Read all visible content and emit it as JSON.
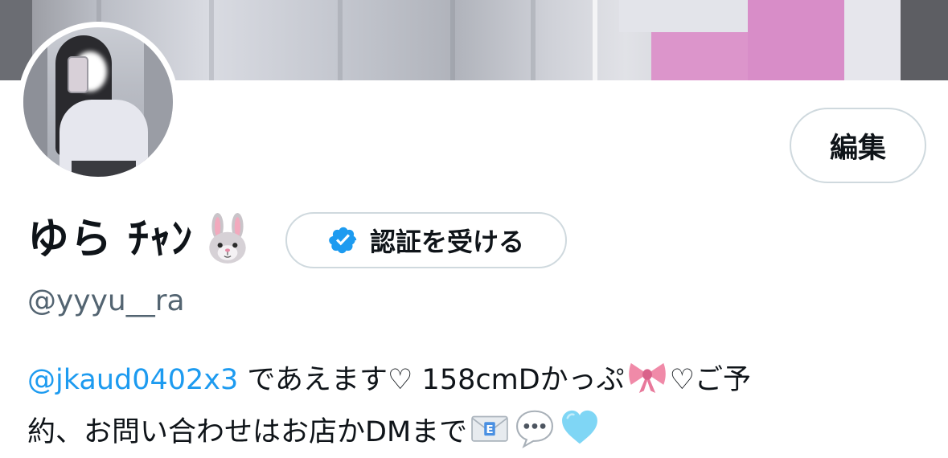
{
  "banner": {
    "image_description_icon": "banner-photo"
  },
  "avatar": {
    "icon": "profile-avatar"
  },
  "profile": {
    "display_name": "ゆら ﾁｬﾝ",
    "name_emoji_icon": "rabbit-face-icon",
    "handle": "@yyyu__ra",
    "edit_label": "編集",
    "verify_label": "認証を受ける",
    "verify_icon": "verified-badge-icon",
    "verify_color": "#1d9bf0"
  },
  "bio": {
    "mention": "@jkaud0402x3",
    "line1_text": " であえます♡ 158cmDかっぷ",
    "ribbon_icon": "ribbon-icon",
    "line1_tail": "♡ご予",
    "line2_text": "約、お問い合わせはお店かDMまで",
    "envelope_icon": "incoming-envelope-icon",
    "speech_icon": "speech-balloon-icon",
    "heart_icon": "light-blue-heart-icon",
    "mention_color": "#1d9bf0"
  }
}
